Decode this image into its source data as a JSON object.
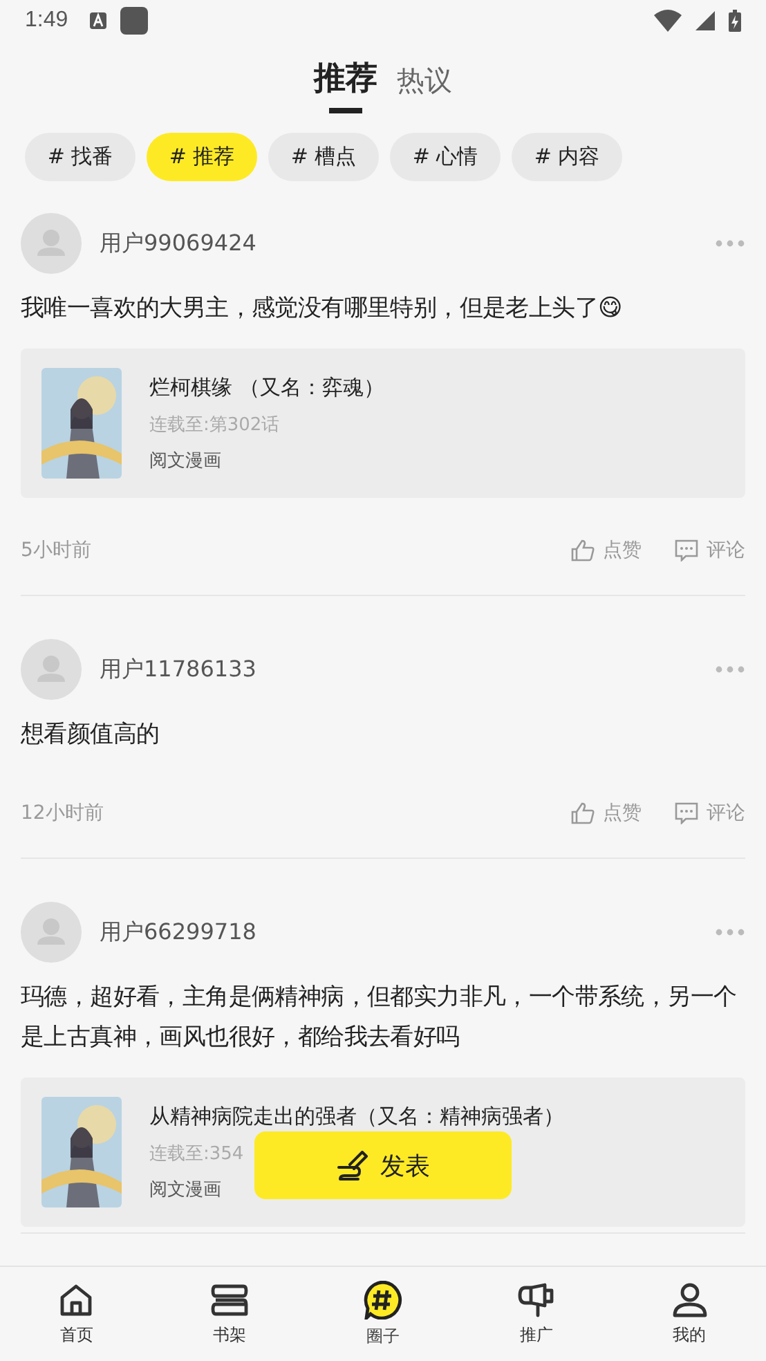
{
  "status_bar": {
    "time": "1:49"
  },
  "tabs": [
    {
      "label": "推荐",
      "selected": true
    },
    {
      "label": "热议",
      "selected": false
    }
  ],
  "chips": [
    {
      "label": "# 找番",
      "selected": false
    },
    {
      "label": "# 推荐",
      "selected": true
    },
    {
      "label": "# 槽点",
      "selected": false
    },
    {
      "label": "# 心情",
      "selected": false
    },
    {
      "label": "# 内容",
      "selected": false
    }
  ],
  "posts": [
    {
      "user": "用户99069424",
      "text": "我唯一喜欢的大男主，感觉没有哪里特别，但是老上头了😋",
      "comic": {
        "kind": "picture",
        "title": "烂柯棋缘 （又名：弈魂）",
        "progress": "连载至:第302话",
        "publisher": "阅文漫画"
      },
      "time": "5小时前",
      "like": "点赞",
      "comment": "评论"
    },
    {
      "user": "用户11786133",
      "text": "想看颜值高的",
      "time": "12小时前",
      "like": "点赞",
      "comment": "评论"
    },
    {
      "user": "用户66299718",
      "text": "玛德，超好看，主角是俩精神病，但都实力非凡，一个带系统，另一个是上古真神，画风也很好，都给我去看好吗",
      "comic": {
        "kind": "picture",
        "title": "从精神病院走出的强者（又名：精神病强者）",
        "progress": "连载至:354",
        "publisher": "阅文漫画"
      }
    }
  ],
  "publish_button": "发表",
  "nav": [
    {
      "label": "首页",
      "kind": "home",
      "selected": false
    },
    {
      "label": "书架",
      "kind": "shelf",
      "selected": false
    },
    {
      "label": "圈子",
      "kind": "circle",
      "selected": true
    },
    {
      "label": "推广",
      "kind": "promo",
      "selected": false
    },
    {
      "label": "我的",
      "kind": "me",
      "selected": false
    }
  ]
}
